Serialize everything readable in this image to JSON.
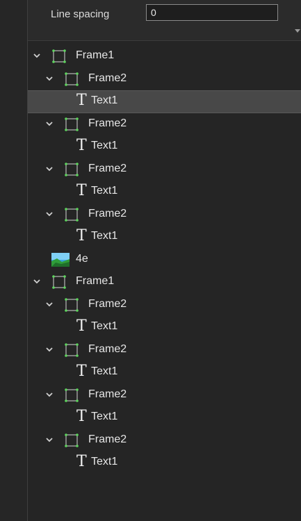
{
  "properties": {
    "line_spacing_label": "Line spacing",
    "line_spacing_value": "0"
  },
  "tree": [
    {
      "type": "frame",
      "label": "Frame1",
      "level": 0,
      "selected": false
    },
    {
      "type": "frame",
      "label": "Frame2",
      "level": 1,
      "selected": false
    },
    {
      "type": "text",
      "label": "Text1",
      "level": 2,
      "selected": true
    },
    {
      "type": "frame",
      "label": "Frame2",
      "level": 1,
      "selected": false
    },
    {
      "type": "text",
      "label": "Text1",
      "level": 2,
      "selected": false
    },
    {
      "type": "frame",
      "label": "Frame2",
      "level": 1,
      "selected": false
    },
    {
      "type": "text",
      "label": "Text1",
      "level": 2,
      "selected": false
    },
    {
      "type": "frame",
      "label": "Frame2",
      "level": 1,
      "selected": false
    },
    {
      "type": "text",
      "label": "Text1",
      "level": 2,
      "selected": false
    },
    {
      "type": "image",
      "label": "4e",
      "level": 0,
      "selected": false
    },
    {
      "type": "frame",
      "label": "Frame1",
      "level": 0,
      "selected": false
    },
    {
      "type": "frame",
      "label": "Frame2",
      "level": 1,
      "selected": false
    },
    {
      "type": "text",
      "label": "Text1",
      "level": 2,
      "selected": false
    },
    {
      "type": "frame",
      "label": "Frame2",
      "level": 1,
      "selected": false
    },
    {
      "type": "text",
      "label": "Text1",
      "level": 2,
      "selected": false
    },
    {
      "type": "frame",
      "label": "Frame2",
      "level": 1,
      "selected": false
    },
    {
      "type": "text",
      "label": "Text1",
      "level": 2,
      "selected": false
    },
    {
      "type": "frame",
      "label": "Frame2",
      "level": 1,
      "selected": false
    },
    {
      "type": "text",
      "label": "Text1",
      "level": 2,
      "selected": false
    }
  ],
  "icons": {
    "frame": "frame-icon",
    "text": "text-type-icon",
    "image": "image-icon",
    "chevron": "chevron-down-icon"
  },
  "colors": {
    "background": "#262626",
    "selection": "#484848",
    "frame_node": "#5ed65e"
  }
}
